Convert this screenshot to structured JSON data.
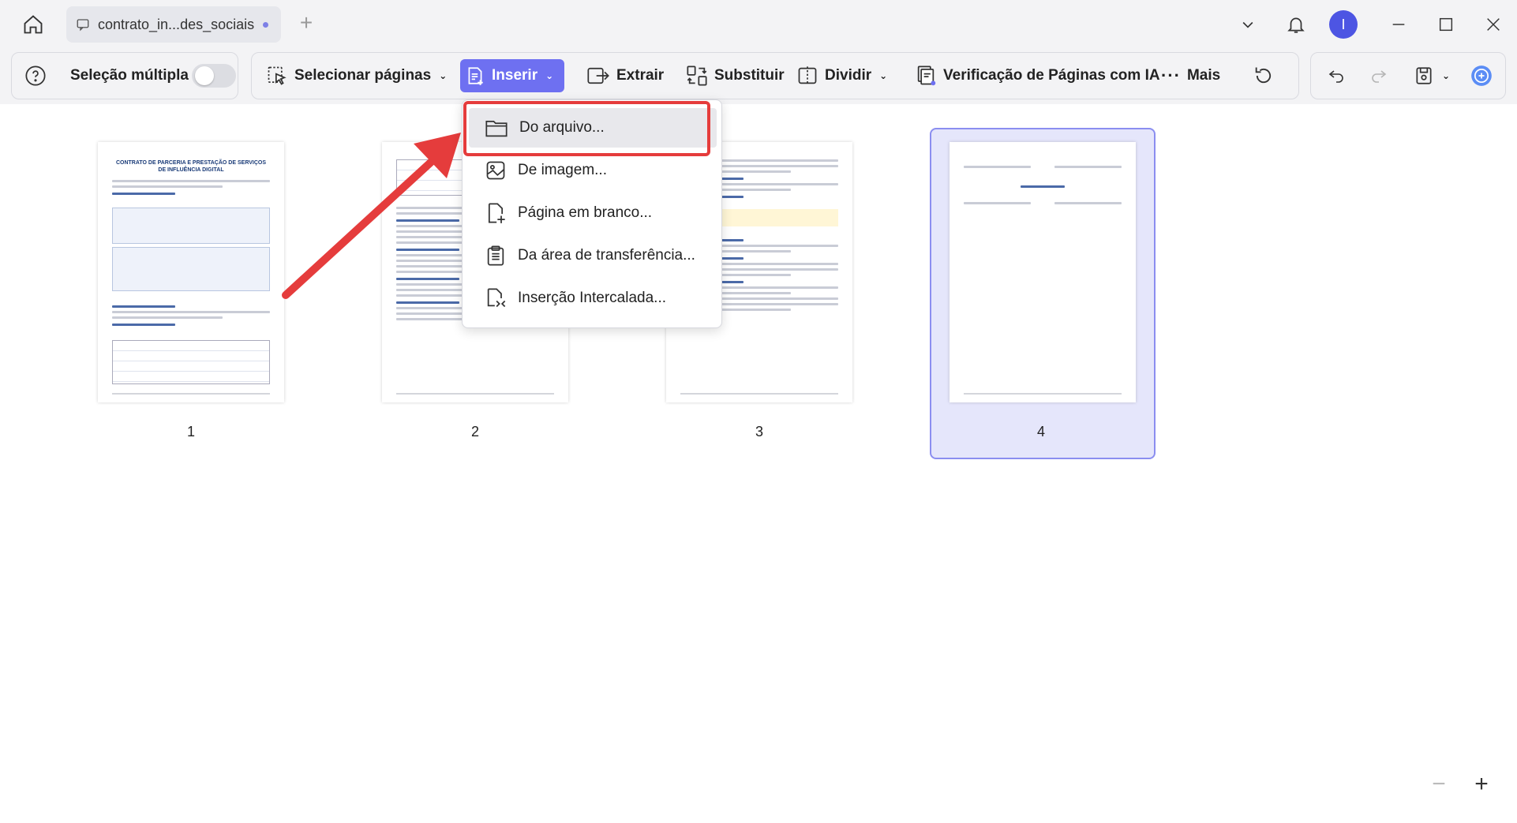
{
  "titlebar": {
    "tab_title": "contrato_in...des_sociais",
    "avatar_initial": "I"
  },
  "toolbar": {
    "multi_select_label": "Seleção múltipla",
    "select_pages_label": "Selecionar páginas",
    "insert_label": "Inserir",
    "extract_label": "Extrair",
    "replace_label": "Substituir",
    "split_label": "Dividir",
    "ai_check_label": "Verificação de Páginas com IA",
    "more_label": "Mais"
  },
  "insert_menu": {
    "items": [
      {
        "label": "Do arquivo...",
        "icon": "folder-icon"
      },
      {
        "label": "De imagem...",
        "icon": "image-icon"
      },
      {
        "label": "Página em branco...",
        "icon": "blank-page-icon"
      },
      {
        "label": "Da área de transferência...",
        "icon": "clipboard-icon"
      },
      {
        "label": "Inserção Intercalada...",
        "icon": "interleave-icon"
      }
    ]
  },
  "pages": [
    {
      "number": "1",
      "title": "CONTRATO DE PARCERIA E PRESTAÇÃO DE SERVIÇOS DE INFLUÊNCIA DIGITAL"
    },
    {
      "number": "2"
    },
    {
      "number": "3"
    },
    {
      "number": "4",
      "selected": true
    }
  ],
  "colors": {
    "accent": "#6e70f1",
    "highlight": "#e53c3c",
    "selection": "#e5e6fb"
  }
}
